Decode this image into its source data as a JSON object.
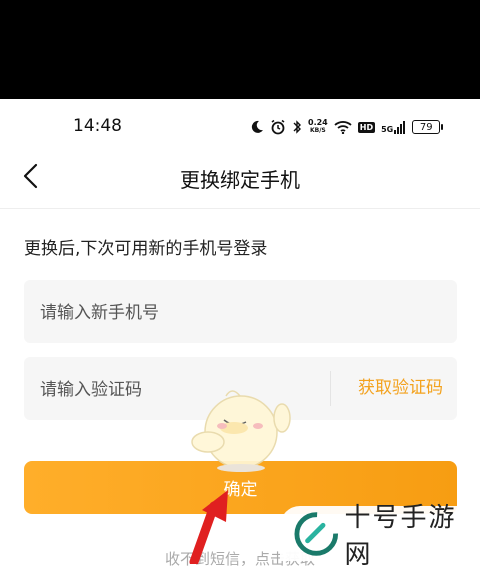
{
  "status_bar": {
    "time": "14:48",
    "net_speed_value": "0.24",
    "net_speed_unit": "KB/S",
    "hd_label": "HD",
    "network_label": "5G",
    "battery_level": "79",
    "icons": [
      "moon-icon",
      "alarm-icon",
      "bluetooth-icon",
      "wifi-icon",
      "signal-icon"
    ]
  },
  "nav": {
    "title": "更换绑定手机",
    "back_icon": "chevron-left-icon"
  },
  "hint": "更换后,下次可用新的手机号登录",
  "form": {
    "phone_placeholder": "请输入新手机号",
    "code_placeholder": "请输入验证码",
    "get_code_label": "获取验证码",
    "confirm_label": "确定"
  },
  "footer": {
    "link_text": "收不到短信，点击获取"
  },
  "watermark": {
    "brand": "十号手游网"
  },
  "colors": {
    "accent": "#f3a21e",
    "button_start": "#ffae2a",
    "button_end": "#f79d12",
    "field_bg": "#f6f6f6",
    "arrow": "#e02020"
  }
}
